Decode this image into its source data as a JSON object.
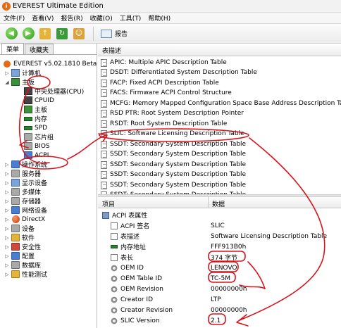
{
  "window": {
    "title": "EVEREST Ultimate Edition",
    "app_icon": "i"
  },
  "menu": [
    "文件(F)",
    "查看(V)",
    "报告(R)",
    "收藏(O)",
    "工具(T)",
    "帮助(H)"
  ],
  "toolbar": {
    "report_label": "报告"
  },
  "left_tabs": [
    "菜单",
    "收藏夹"
  ],
  "tree": [
    {
      "label": "EVEREST v5.02.1810 Beta",
      "exp": "",
      "icon": "everest-icon"
    },
    {
      "label": "计算机",
      "exp": "▷",
      "icon": "computer-icon"
    },
    {
      "label": "主板",
      "exp": "◢",
      "icon": "motherboard-icon"
    },
    {
      "label": "中央处理器(CPU)",
      "exp": "",
      "icon": "cpu-icon"
    },
    {
      "label": "CPUID",
      "exp": "",
      "icon": "cpuid-icon"
    },
    {
      "label": "主板",
      "exp": "",
      "icon": "motherboard-icon"
    },
    {
      "label": "内存",
      "exp": "",
      "icon": "memory-icon"
    },
    {
      "label": "SPD",
      "exp": "",
      "icon": "spd-icon"
    },
    {
      "label": "芯片组",
      "exp": "",
      "icon": "chipset-icon"
    },
    {
      "label": "BIOS",
      "exp": "",
      "icon": "bios-icon"
    },
    {
      "label": "ACPI",
      "exp": "",
      "icon": "acpi-icon"
    },
    {
      "label": "操作系统",
      "exp": "▷",
      "icon": "os-icon"
    },
    {
      "label": "服务器",
      "exp": "▷",
      "icon": "server-icon"
    },
    {
      "label": "显示设备",
      "exp": "▷",
      "icon": "display-icon"
    },
    {
      "label": "多媒体",
      "exp": "▷",
      "icon": "multimedia-icon"
    },
    {
      "label": "存储器",
      "exp": "▷",
      "icon": "storage-icon"
    },
    {
      "label": "网络设备",
      "exp": "▷",
      "icon": "network-icon"
    },
    {
      "label": "DirectX",
      "exp": "▷",
      "icon": "directx-icon"
    },
    {
      "label": "设备",
      "exp": "▷",
      "icon": "devices-icon"
    },
    {
      "label": "软件",
      "exp": "▷",
      "icon": "software-icon"
    },
    {
      "label": "安全性",
      "exp": "▷",
      "icon": "security-icon"
    },
    {
      "label": "配置",
      "exp": "▷",
      "icon": "config-icon"
    },
    {
      "label": "数据库",
      "exp": "▷",
      "icon": "database-icon"
    },
    {
      "label": "性能测试",
      "exp": "▷",
      "icon": "benchmark-icon"
    }
  ],
  "table_section": {
    "header": "表描述",
    "rows": [
      "APIC: Multiple APIC Description Table",
      "DSDT: Differentiated System Description Table",
      "FACP: Fixed ACPI Description Table",
      "FACS: Firmware ACPI Control Structure",
      "MCFG: Memory Mapped Configuration Space Base Address Description Table",
      "RSD PTR: Root System Description Pointer",
      "RSDT: Root System Description Table",
      "SLIC: Software Licensing Description Table",
      "SSDT: Secondary System Description Table",
      "SSDT: Secondary System Description Table",
      "SSDT: Secondary System Description Table",
      "SSDT: Secondary System Description Table",
      "SSDT: Secondary System Description Table",
      "SSDT: Secondary System Description Table"
    ]
  },
  "props_section": {
    "col_item": "项目",
    "col_data": "数据",
    "group": "ACPI 表属性",
    "rows": [
      {
        "name": "ACPI 签名",
        "value": "SLIC",
        "icon": "doc-icon"
      },
      {
        "name": "表描述",
        "value": "Software Licensing Description Table",
        "icon": "doc-icon"
      },
      {
        "name": "内存地址",
        "value": "FFF913B0h",
        "icon": "ram-icon"
      },
      {
        "name": "表长",
        "value": "374 字节",
        "icon": "doc-icon"
      },
      {
        "name": "OEM ID",
        "value": "LENOVO",
        "icon": "gear-icon"
      },
      {
        "name": "OEM Table ID",
        "value": "TC-5M",
        "icon": "gear-icon"
      },
      {
        "name": "OEM Revision",
        "value": "00000000h",
        "icon": "gear-icon"
      },
      {
        "name": "Creator ID",
        "value": "LTP",
        "icon": "gear-icon"
      },
      {
        "name": "Creator Revision",
        "value": "00000000h",
        "icon": "gear-icon"
      },
      {
        "name": "SLIC Version",
        "value": "2.1",
        "icon": "gear-icon"
      }
    ]
  },
  "colors": {
    "annotation": "#d8141c",
    "toolbar_green": "#2f9a1c"
  }
}
